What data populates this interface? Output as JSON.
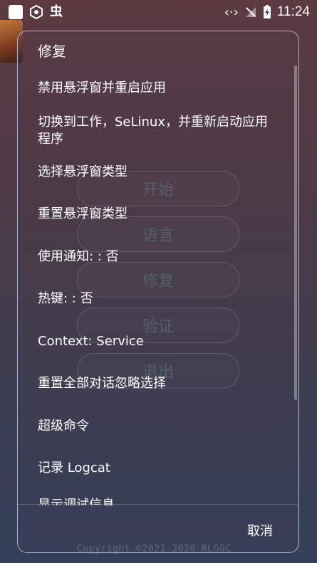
{
  "status_bar": {
    "time": "11:24",
    "app_glyph": "虫"
  },
  "background": {
    "menu": [
      "开始",
      "语言",
      "修复",
      "验证",
      "退出"
    ],
    "copyright": "Copyright ©2021-2030 RLGGC"
  },
  "dialog": {
    "title": "修复",
    "items": [
      "禁用悬浮窗并重启应用",
      "切换到工作，SeLinux，并重新启动应用程序",
      "选择悬浮窗类型",
      "重置悬浮窗类型",
      "使用通知: : 否",
      "热键: : 否",
      "Context: Service",
      "重置全部对话忽略选择",
      "超级命令",
      "记录 Logcat",
      "显示调试信息"
    ],
    "cancel_label": "取消"
  }
}
